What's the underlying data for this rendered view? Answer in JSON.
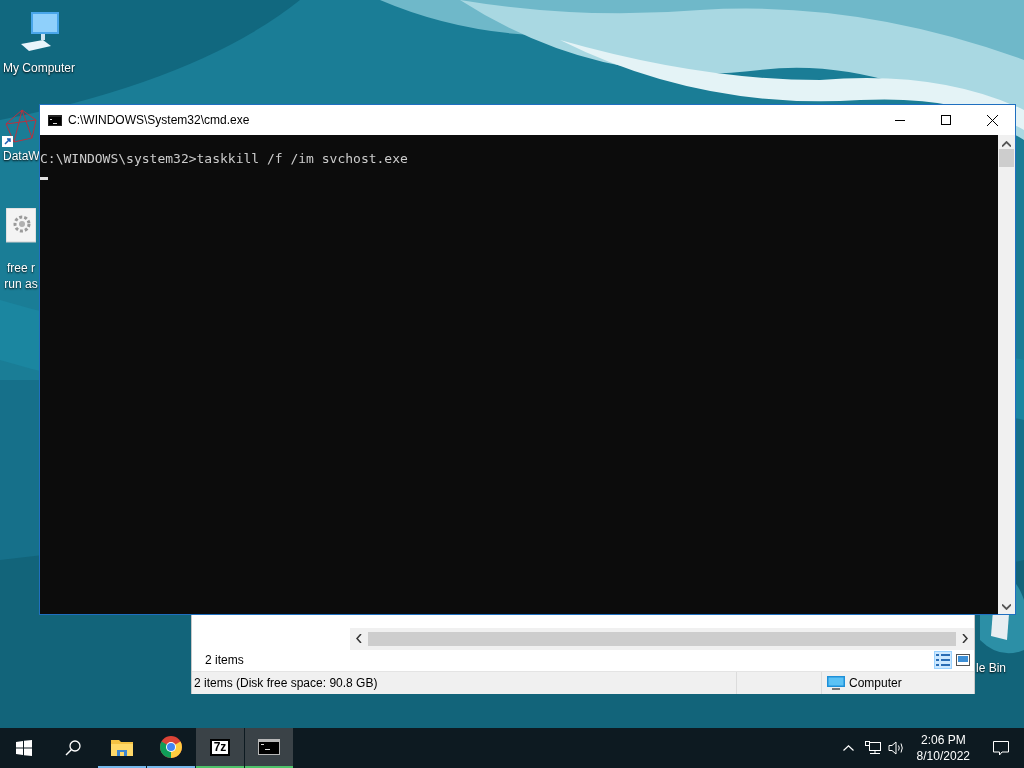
{
  "desktop_icons": [
    {
      "kind": "computer",
      "lines": [
        "My Computer"
      ]
    },
    {
      "kind": "network-shortcut",
      "lines": [
        "DataW"
      ]
    },
    {
      "kind": "gear-file",
      "lines": [
        "free r",
        "run as"
      ]
    },
    {
      "kind": "recycle-bin",
      "lines": [
        "le Bin"
      ]
    }
  ],
  "explorer_window": {
    "item_count": "2 items",
    "status_text": "2 items (Disk free space: 90.8 GB)",
    "location": "Computer",
    "views": [
      {
        "kind": "details",
        "selected": true
      },
      {
        "kind": "preview",
        "selected": false
      }
    ]
  },
  "cmd_window": {
    "title": "C:\\WINDOWS\\System32\\cmd.exe",
    "lines": [
      "C:\\WINDOWS\\system32>taskkill /f /im svchost.exe"
    ]
  },
  "taskbar": {
    "apps": [
      {
        "kind": "start",
        "running": false,
        "active": false
      },
      {
        "kind": "search",
        "running": false,
        "active": false
      },
      {
        "kind": "folder",
        "running": true,
        "active": false
      },
      {
        "kind": "chrome",
        "running": true,
        "active": false
      },
      {
        "kind": "archiver",
        "label": "7z",
        "running": true,
        "active": true
      },
      {
        "kind": "console",
        "running": true,
        "active": true
      }
    ],
    "time": "2:06 PM",
    "date": "8/10/2022"
  }
}
